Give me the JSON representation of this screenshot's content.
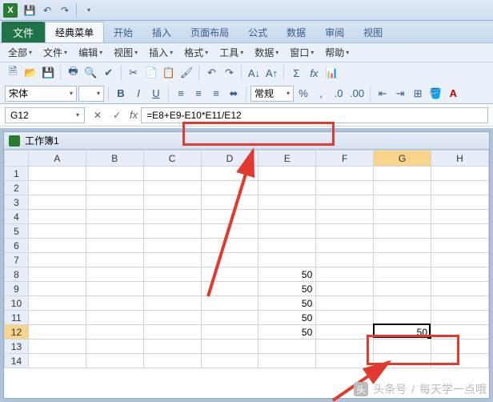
{
  "qat": {
    "save": "💾",
    "undo": "↶",
    "redo": "↷"
  },
  "tabs": {
    "file": "文件",
    "items": [
      "经典菜单",
      "开始",
      "插入",
      "页面布局",
      "公式",
      "数据",
      "审阅",
      "视图"
    ],
    "active_index": 0
  },
  "menus": [
    "全部",
    "文件",
    "编辑",
    "视图",
    "插入",
    "格式",
    "工具",
    "数据",
    "窗口",
    "帮助"
  ],
  "toolbar1": {
    "new": "🗎",
    "open": "📂",
    "save": "💾",
    "print": "🖶",
    "preview": "🔍",
    "spell": "✔",
    "cut": "✂",
    "copy": "📄",
    "paste": "📋",
    "format_paint": "🖌",
    "undo": "↶",
    "redo": "↷",
    "sort_asc": "A↓",
    "sort_desc": "A↑",
    "sigma": "Σ",
    "fx": "fx",
    "chart": "📊"
  },
  "toolbar2": {
    "font_name": "宋体",
    "font_size": "",
    "bold": "B",
    "italic": "I",
    "underline": "U",
    "align_left": "≡",
    "align_center": "≡",
    "align_right": "≡",
    "merge": "⬌",
    "number_group": "常规",
    "percent": "%",
    "comma": ",",
    "inc_dec": ".0",
    "dec_dec": ".00",
    "indent_dec": "⇤",
    "indent_inc": "⇥",
    "border": "⊞",
    "fill": "🪣",
    "font_color": "A"
  },
  "namebox": "G12",
  "formula": "=E8+E9-E10*E11/E12",
  "workbook_title": "工作簿1",
  "columns": [
    "A",
    "B",
    "C",
    "D",
    "E",
    "F",
    "G",
    "H"
  ],
  "rows": [
    1,
    2,
    3,
    4,
    5,
    6,
    7,
    8,
    9,
    10,
    11,
    12,
    13,
    14
  ],
  "cell_data": {
    "E8": "50",
    "E9": "50",
    "E10": "50",
    "E11": "50",
    "E12": "50",
    "G12": "50"
  },
  "active_row": 12,
  "active_col": "G",
  "chart_data": null,
  "watermark": {
    "source": "头条号",
    "author": "每天学一点哦"
  }
}
